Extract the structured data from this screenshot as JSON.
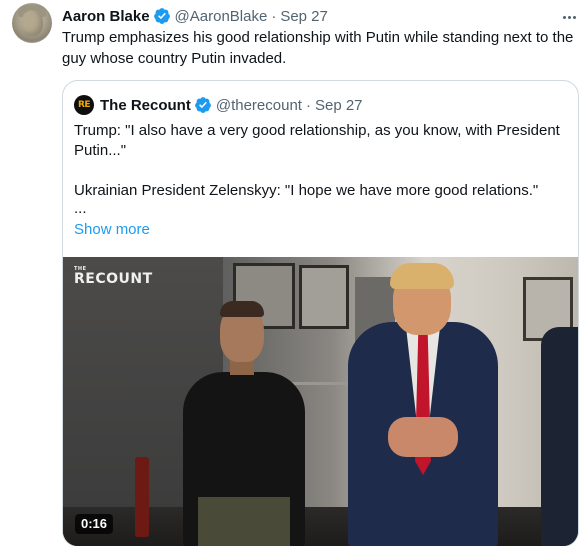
{
  "tweet": {
    "author_name": "Aaron Blake",
    "author_handle": "@AaronBlake",
    "separator": "·",
    "date": "Sep 27",
    "text": "Trump emphasizes his good relationship with Putin while standing next to the guy whose country Putin invaded.",
    "verified": true
  },
  "quoted_tweet": {
    "avatar_text": "RE",
    "author_name": "The Recount",
    "author_handle": "@therecount",
    "separator": "·",
    "date": "Sep 27",
    "verified": true,
    "lines": [
      "Trump: \"I also have a very good relationship, as you know, with President Putin...\"",
      "Ukrainian President Zelenskyy: \"I hope we have more good relations.\"",
      "..."
    ],
    "show_more": "Show more"
  },
  "video": {
    "logo_small": "THE",
    "logo_large": "RECOUNT",
    "duration": "0:16"
  },
  "icons": {
    "verified": "verified-badge-icon",
    "more": "more-options-icon"
  },
  "colors": {
    "text_primary": "#0f1419",
    "text_secondary": "#536471",
    "link": "#1d9bf0",
    "verified": "#1d9bf0",
    "border": "#cfd9de"
  }
}
